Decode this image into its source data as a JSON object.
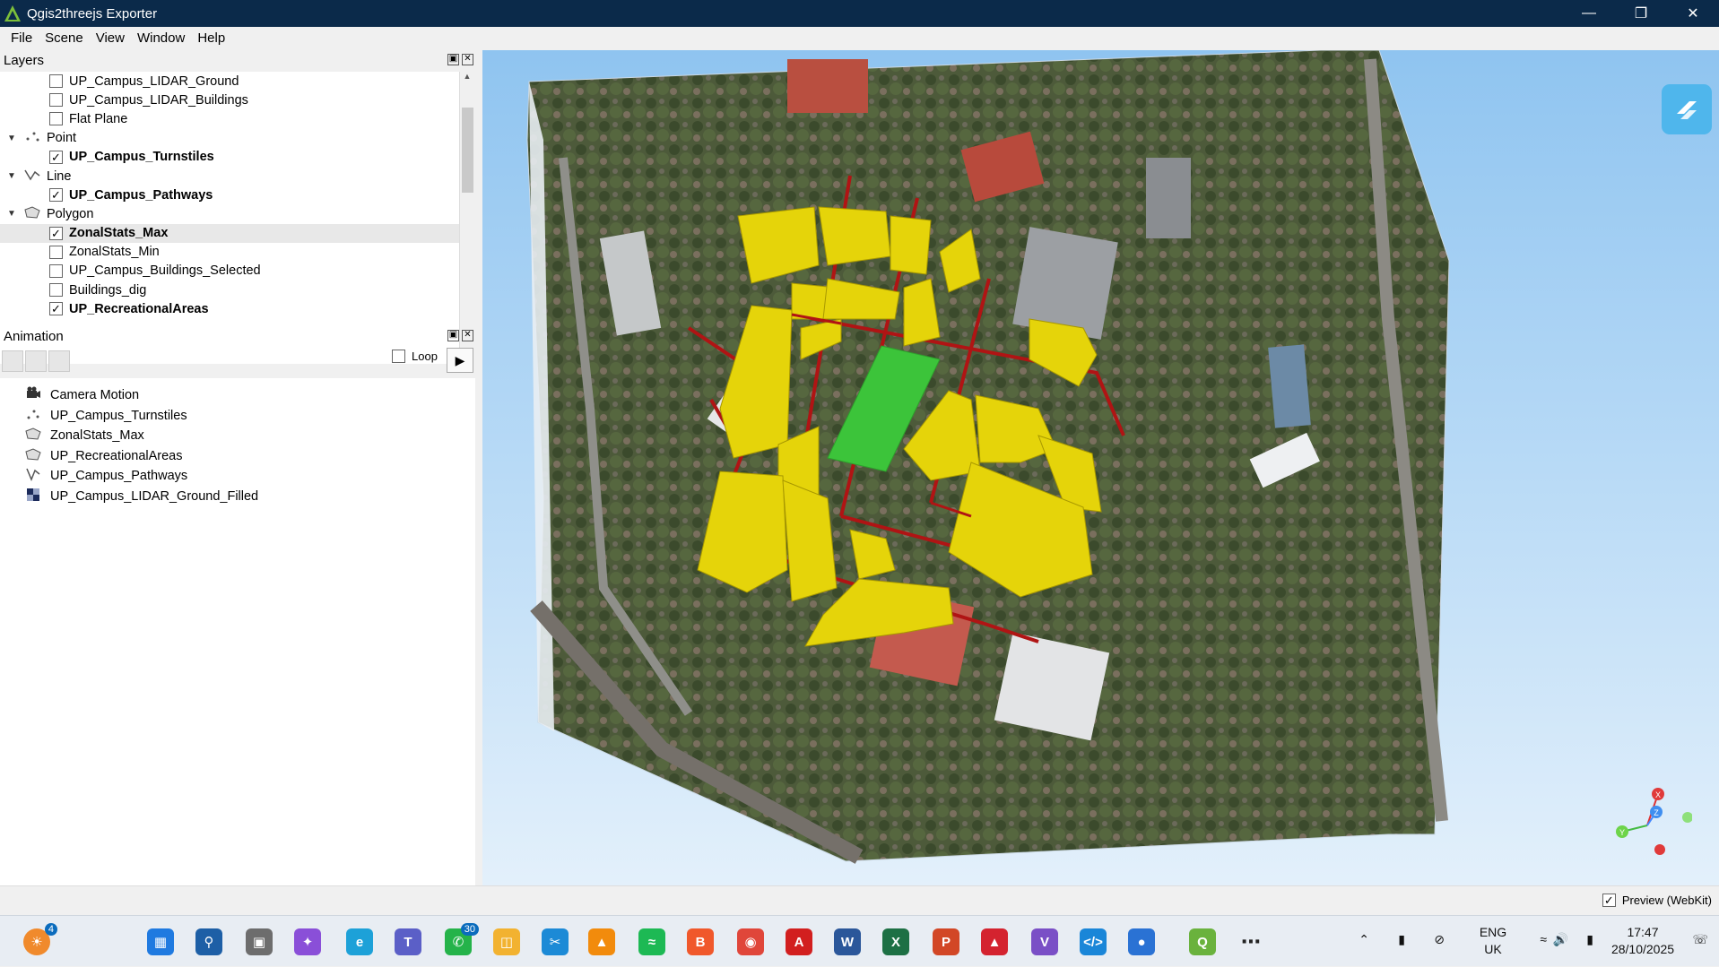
{
  "window": {
    "title": "Qgis2threejs Exporter"
  },
  "menu": [
    "File",
    "Scene",
    "View",
    "Window",
    "Help"
  ],
  "layers_panel": {
    "title": "Layers",
    "rows": [
      {
        "type": "layer",
        "label": "UP_Campus_LIDAR_Ground",
        "checked": false,
        "bold": false
      },
      {
        "type": "layer",
        "label": "UP_Campus_LIDAR_Buildings",
        "checked": false,
        "bold": false
      },
      {
        "type": "layer",
        "label": "Flat Plane",
        "checked": false,
        "bold": false
      },
      {
        "type": "group",
        "label": "Point",
        "icon": "point-group-icon"
      },
      {
        "type": "layer",
        "label": "UP_Campus_Turnstiles",
        "checked": true,
        "bold": true
      },
      {
        "type": "group",
        "label": "Line",
        "icon": "line-group-icon"
      },
      {
        "type": "layer",
        "label": "UP_Campus_Pathways",
        "checked": true,
        "bold": true
      },
      {
        "type": "group",
        "label": "Polygon",
        "icon": "polygon-group-icon"
      },
      {
        "type": "layer",
        "label": "ZonalStats_Max",
        "checked": true,
        "bold": true,
        "selected": true
      },
      {
        "type": "layer",
        "label": "ZonalStats_Min",
        "checked": false,
        "bold": false
      },
      {
        "type": "layer",
        "label": "UP_Campus_Buildings_Selected",
        "checked": false,
        "bold": false
      },
      {
        "type": "layer",
        "label": "Buildings_dig",
        "checked": false,
        "bold": false
      },
      {
        "type": "layer",
        "label": "UP_RecreationalAreas",
        "checked": true,
        "bold": true
      }
    ]
  },
  "animation_panel": {
    "title": "Animation",
    "loop_label": "Loop",
    "loop_checked": false,
    "items": [
      {
        "label": "Camera Motion",
        "icon": "camera-icon"
      },
      {
        "label": "UP_Campus_Turnstiles",
        "icon": "point-layer-icon"
      },
      {
        "label": "ZonalStats_Max",
        "icon": "polygon-layer-icon"
      },
      {
        "label": "UP_RecreationalAreas",
        "icon": "polygon-layer-icon"
      },
      {
        "label": "UP_Campus_Pathways",
        "icon": "line-layer-icon"
      },
      {
        "label": "UP_Campus_LIDAR_Ground_Filled",
        "icon": "raster-layer-icon"
      }
    ]
  },
  "viewport": {
    "colors": {
      "buildings": "#e5d40a",
      "recreational": "#3cc43a",
      "pathways": "#b01414",
      "sky_top": "#8fc4f0"
    },
    "gizmo_axes": [
      "X",
      "Y",
      "Z"
    ]
  },
  "statusbar": {
    "preview_label": "Preview (WebKit)",
    "preview_checked": true
  },
  "taskbar": {
    "icons": [
      {
        "name": "weather-widget-icon",
        "badge": "4"
      },
      {
        "name": "start-icon"
      },
      {
        "name": "search-icon"
      },
      {
        "name": "task-view-icon"
      },
      {
        "name": "copilot-icon"
      },
      {
        "name": "edge-icon"
      },
      {
        "name": "teams-icon"
      },
      {
        "name": "whatsapp-icon",
        "badge": "30"
      },
      {
        "name": "file-explorer-icon"
      },
      {
        "name": "snipping-tool-icon"
      },
      {
        "name": "vlc-icon"
      },
      {
        "name": "spotify-icon"
      },
      {
        "name": "brave-icon"
      },
      {
        "name": "chrome-icon"
      },
      {
        "name": "acrobat-icon"
      },
      {
        "name": "word-icon"
      },
      {
        "name": "excel-icon"
      },
      {
        "name": "powerpoint-icon"
      },
      {
        "name": "arcgis-icon"
      },
      {
        "name": "visual-studio-icon"
      },
      {
        "name": "vscode-icon"
      },
      {
        "name": "app-icon"
      },
      {
        "name": "qgis-icon"
      },
      {
        "name": "more-icon"
      }
    ],
    "tray": {
      "lang_line1": "ENG",
      "lang_line2": "UK",
      "time": "17:47",
      "date": "28/10/2025"
    }
  }
}
